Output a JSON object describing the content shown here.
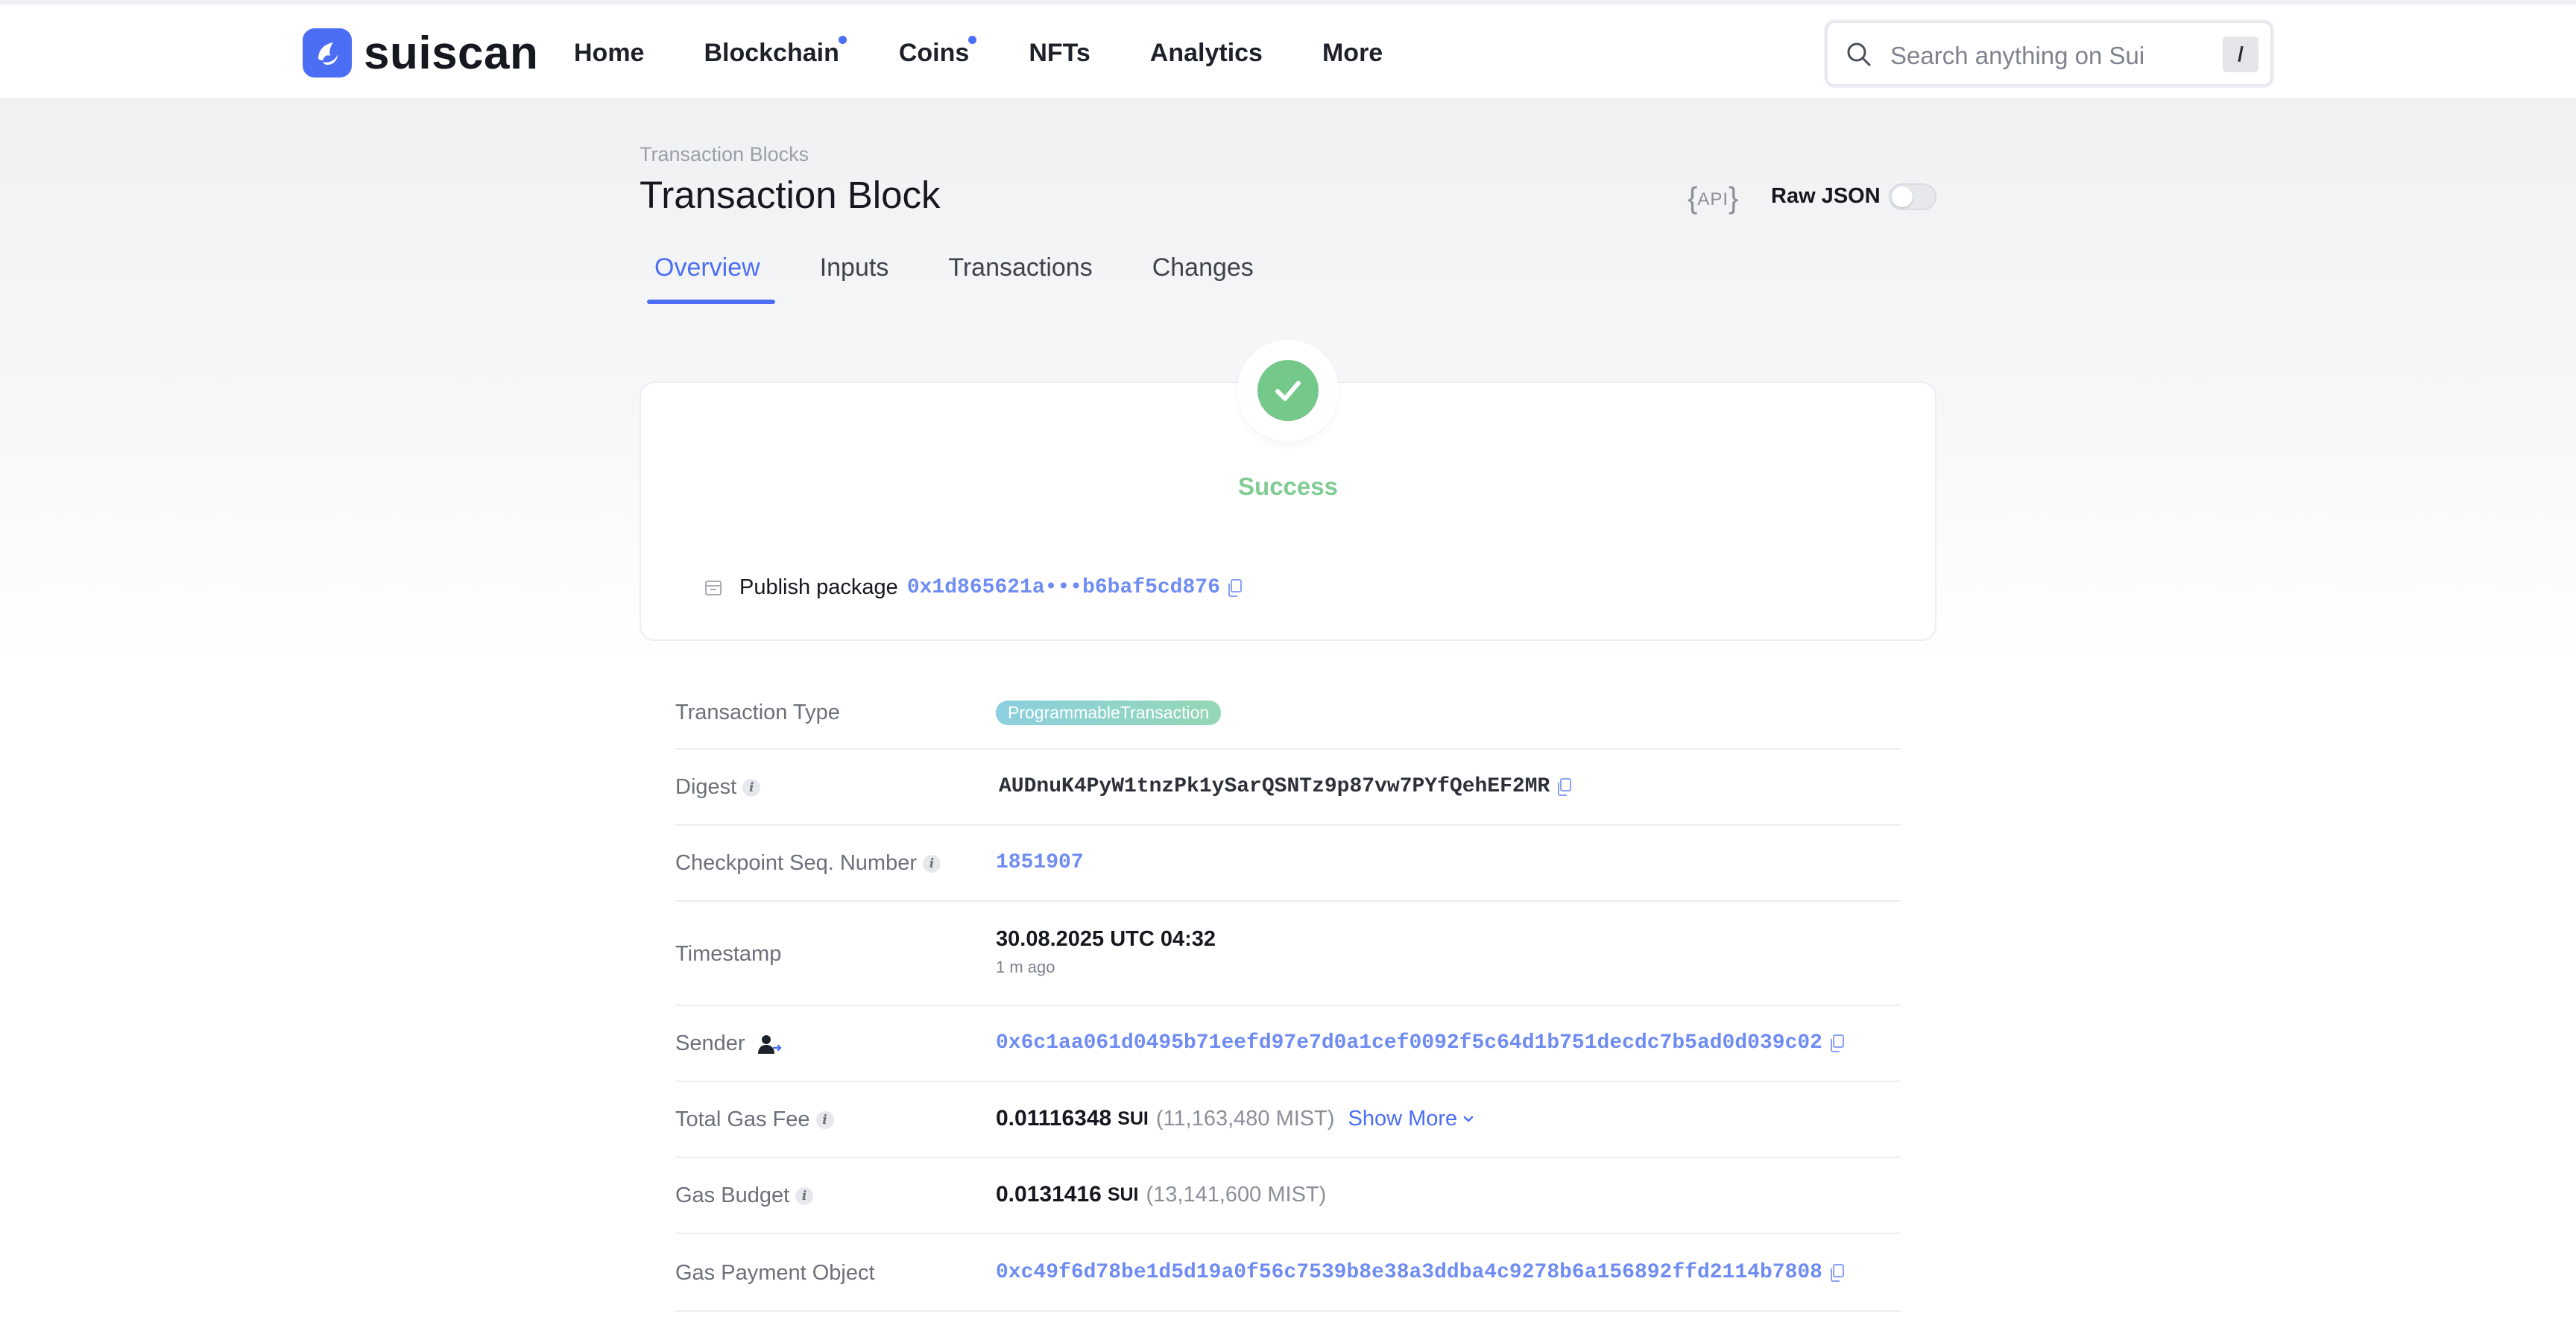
{
  "brand": {
    "name": "suiscan",
    "accent": "#4b6ef5"
  },
  "nav": {
    "items": [
      {
        "label": "Home",
        "dot": false
      },
      {
        "label": "Blockchain",
        "dot": true
      },
      {
        "label": "Coins",
        "dot": true
      },
      {
        "label": "NFTs",
        "dot": false
      },
      {
        "label": "Analytics",
        "dot": false
      },
      {
        "label": "More",
        "dot": false
      }
    ]
  },
  "search": {
    "placeholder": "Search anything on Sui",
    "shortcut": "/"
  },
  "page": {
    "breadcrumb": "Transaction Blocks",
    "title": "Transaction Block",
    "api_label": "API",
    "raw_json_label": "Raw JSON",
    "raw_json_enabled": false
  },
  "tabs": [
    {
      "label": "Overview",
      "active": true
    },
    {
      "label": "Inputs",
      "active": false
    },
    {
      "label": "Transactions",
      "active": false
    },
    {
      "label": "Changes",
      "active": false
    }
  ],
  "status": {
    "text": "Success",
    "color": "#74c98a",
    "action_label": "Publish package",
    "package_id": "0x1d865621a•••b6baf5cd876"
  },
  "details": {
    "transaction_type": {
      "label": "Transaction Type",
      "value": "ProgrammableTransaction"
    },
    "digest": {
      "label": "Digest",
      "value": "AUDnuK4PyW1tnzPk1ySarQSNTz9p87vw7PYfQehEF2MR"
    },
    "checkpoint": {
      "label": "Checkpoint Seq. Number",
      "value": "1851907"
    },
    "timestamp": {
      "label": "Timestamp",
      "value": "30.08.2025 UTC 04:32",
      "relative": "1 m ago"
    },
    "sender": {
      "label": "Sender",
      "value": "0x6c1aa061d0495b71eefd97e7d0a1cef0092f5c64d1b751decdc7b5ad0d039c02"
    },
    "total_gas_fee": {
      "label": "Total Gas Fee",
      "amount": "0.01116348",
      "unit": "SUI",
      "mist": "(11,163,480 MIST)",
      "show_more": "Show More"
    },
    "gas_budget": {
      "label": "Gas Budget",
      "amount": "0.0131416",
      "unit": "SUI",
      "mist": "(13,141,600 MIST)"
    },
    "gas_payment_object": {
      "label": "Gas Payment Object",
      "value": "0xc49f6d78be1d5d19a0f56c7539b8e38a3ddba4c9278b6a156892ffd2114b7808"
    }
  }
}
